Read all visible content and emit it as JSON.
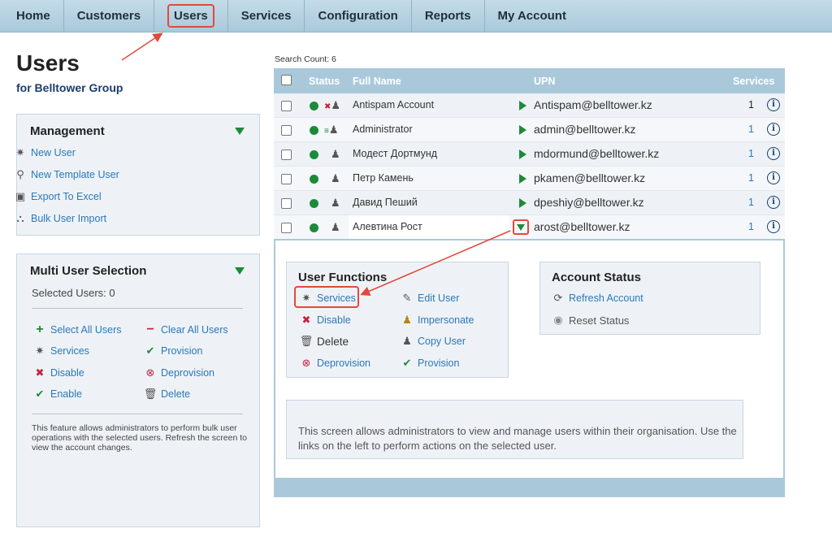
{
  "nav": [
    "Home",
    "Customers",
    "Users",
    "Services",
    "Configuration",
    "Reports",
    "My Account"
  ],
  "page": {
    "title": "Users",
    "subtitle": "for Belltower Group"
  },
  "management": {
    "title": "Management",
    "items": [
      "New User",
      "New Template User",
      "Export To Excel",
      "Bulk User Import"
    ]
  },
  "multi": {
    "title": "Multi User Selection",
    "selected": "Selected Users: 0",
    "left": [
      "Select All Users",
      "Services",
      "Disable",
      "Enable"
    ],
    "right": [
      "Clear All Users",
      "Provision",
      "Deprovision",
      "Delete"
    ],
    "note": "This feature allows administrators to perform bulk user operations with the selected users. Refresh the screen to view the account changes."
  },
  "table": {
    "search_count": "Search Count:  6",
    "headers": {
      "status": "Status",
      "full_name": "Full Name",
      "upn": "UPN",
      "services": "Services"
    },
    "rows": [
      {
        "name": "Antispam Account",
        "upn": "Antispam@belltower.kz",
        "services": "1"
      },
      {
        "name": "Administrator",
        "upn": "admin@belltower.kz",
        "services": "1"
      },
      {
        "name": "Модест Дортмунд",
        "upn": "mdormund@belltower.kz",
        "services": "1"
      },
      {
        "name": "Петр Камень",
        "upn": "pkamen@belltower.kz",
        "services": "1"
      },
      {
        "name": "Давид Пеший",
        "upn": "dpeshiy@belltower.kz",
        "services": "1"
      },
      {
        "name": "Алевтина Рост",
        "upn": "arost@belltower.kz",
        "services": "1"
      }
    ]
  },
  "user_functions": {
    "title": "User Functions",
    "left": [
      "Services",
      "Disable",
      "Delete",
      "Deprovision"
    ],
    "right": [
      "Edit User",
      "Impersonate",
      "Copy User",
      "Provision"
    ]
  },
  "account_status": {
    "title": "Account Status",
    "items": [
      "Refresh Account",
      "Reset Status"
    ]
  },
  "help": "This screen allows administrators to view and manage users within their organisation. Use the links on the left to perform actions on the selected user.",
  "colors": {
    "nav_bg": "#a9c9db",
    "link": "#2a78b8",
    "status_green": "#1d8a3a",
    "highlight": "#e04a3a"
  }
}
